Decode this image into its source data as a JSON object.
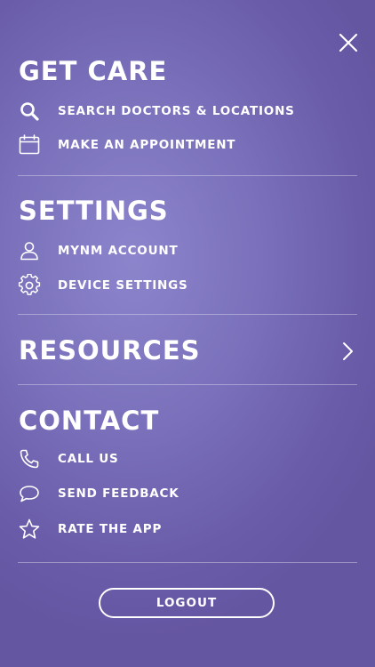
{
  "menu": {
    "close_icon": "close-icon",
    "sections": {
      "get_care": {
        "title": "GET CARE",
        "items": [
          {
            "label": "SEARCH DOCTORS & LOCATIONS",
            "icon": "search-icon"
          },
          {
            "label": "MAKE AN APPOINTMENT",
            "icon": "calendar-icon"
          }
        ]
      },
      "settings": {
        "title": "SETTINGS",
        "items": [
          {
            "label": "MYNM ACCOUNT",
            "icon": "user-icon"
          },
          {
            "label": "DEVICE SETTINGS",
            "icon": "gear-icon"
          }
        ]
      },
      "resources": {
        "title": "RESOURCES",
        "icon": "chevron-right-icon"
      },
      "contact": {
        "title": "CONTACT",
        "items": [
          {
            "label": "CALL US",
            "icon": "phone-icon"
          },
          {
            "label": "SEND FEEDBACK",
            "icon": "chat-bubble-icon"
          },
          {
            "label": "RATE THE APP",
            "icon": "star-icon"
          }
        ]
      }
    },
    "logout_label": "LOGOUT"
  },
  "colors": {
    "background_center": "#8c85cc",
    "background_edge": "#6556a2",
    "text": "#ffffff",
    "divider": "rgba(255,255,255,0.35)"
  }
}
